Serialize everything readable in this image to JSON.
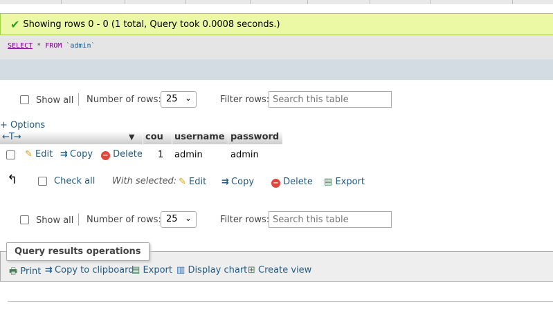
{
  "message": {
    "text": "Showing rows 0 - 0 (1 total, Query took 0.0008 seconds.)"
  },
  "sql": {
    "kw_select": "SELECT",
    "star": "*",
    "kw_from": "FROM",
    "table": "`admin`"
  },
  "nav": {
    "show_all": "Show all",
    "number_of_rows_label": "Number of rows:",
    "rows_value": "25",
    "filter_label": "Filter rows:",
    "search_placeholder": "Search this table"
  },
  "options_link": "+ Options",
  "table": {
    "arrows": "←T→",
    "columns": [
      "cou",
      "username",
      "password"
    ],
    "rows": [
      {
        "edit": "Edit",
        "copy": "Copy",
        "delete": "Delete",
        "cou": "1",
        "username": "admin",
        "password": "admin"
      }
    ]
  },
  "bulk": {
    "check_all": "Check all",
    "with_selected": "With selected:",
    "edit": "Edit",
    "copy": "Copy",
    "delete": "Delete",
    "export": "Export"
  },
  "operations": {
    "legend": "Query results operations",
    "print": "Print",
    "copy_clipboard": "Copy to clipboard",
    "export": "Export",
    "display_chart": "Display chart",
    "create_view": "Create view"
  },
  "colors": {
    "success_bg": "#ebf8a4",
    "link": "#235a81",
    "sql_bar": "#d3dce3"
  }
}
